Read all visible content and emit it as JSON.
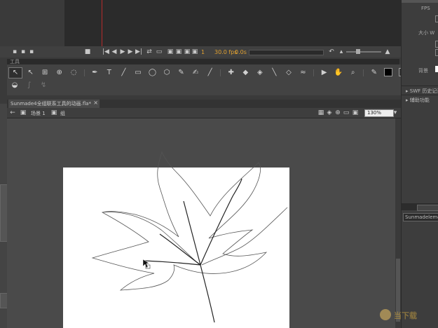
{
  "right_panel": {
    "fps_label": "FPS",
    "size_label": "大小",
    "size_value": "W",
    "color_label": "背景",
    "swf_label": "SWF 历史记录",
    "history_label": "辅助功能",
    "library_item": "Sunmadeleme之作"
  },
  "timeline": {
    "frame_current": "1",
    "fps_value": "30.0",
    "fps_unit": "fps",
    "time_value": "0.0",
    "time_unit": "s"
  },
  "tools_panel": {
    "title": "工具"
  },
  "document": {
    "tab_title": "Sunmade4全组联系工具的动画.fla*",
    "tab_close": "×",
    "scene_label": "场景 1",
    "group_label": "组",
    "zoom_value": "130%"
  },
  "watermark": {
    "text": "当下载"
  },
  "colors": {
    "bg": "#3a3a3a",
    "panel": "#464646",
    "stage": "#ffffff"
  }
}
